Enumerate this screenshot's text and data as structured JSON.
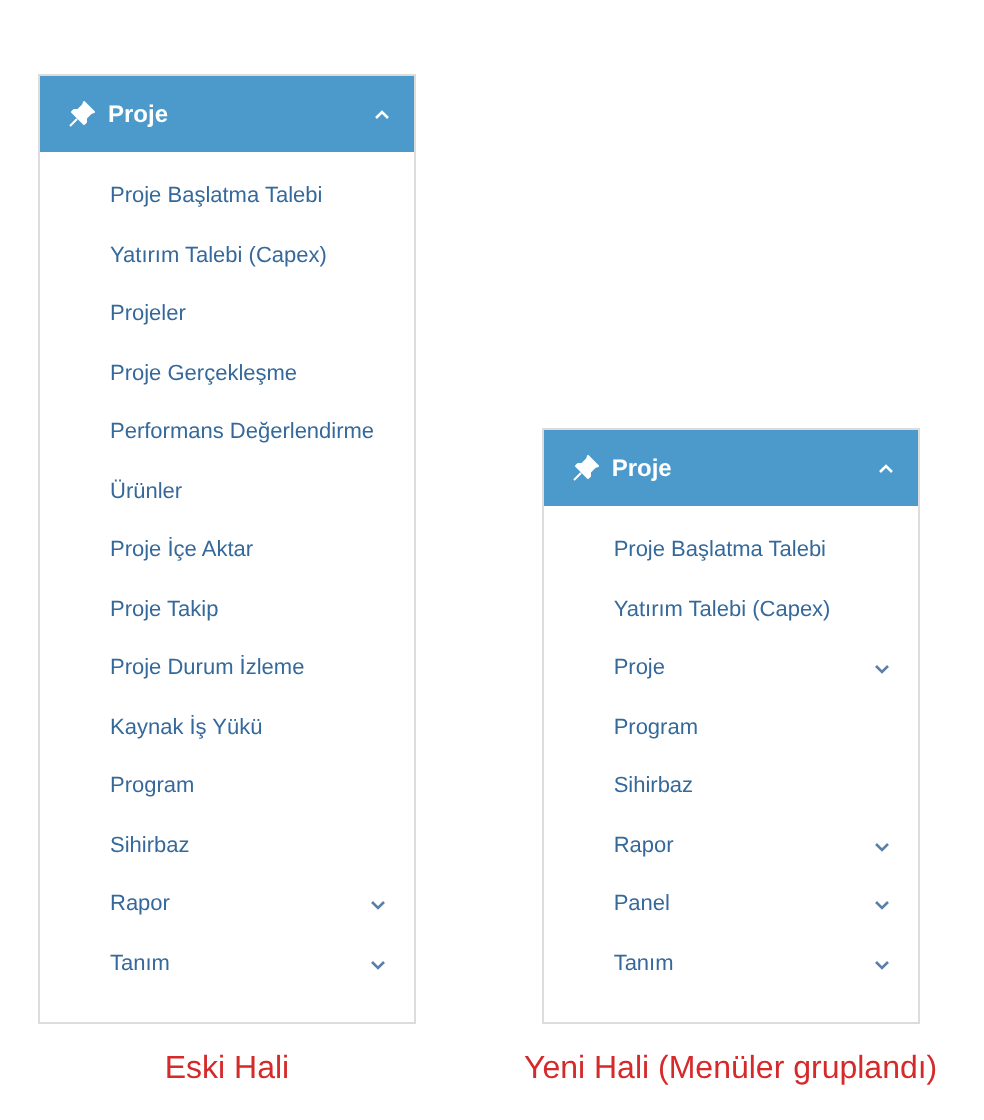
{
  "panels": [
    {
      "header": {
        "title": "Proje",
        "expanded": true
      },
      "items": [
        {
          "kind": "link",
          "label": "Proje Başlatma Talebi"
        },
        {
          "kind": "link",
          "label": "Yatırım Talebi (Capex)"
        },
        {
          "kind": "link",
          "label": "Projeler"
        },
        {
          "kind": "link",
          "label": "Proje Gerçekleşme"
        },
        {
          "kind": "link",
          "label": "Performans Değerlendirme"
        },
        {
          "kind": "link",
          "label": "Ürünler"
        },
        {
          "kind": "link",
          "label": "Proje İçe Aktar"
        },
        {
          "kind": "link",
          "label": "Proje Takip"
        },
        {
          "kind": "link",
          "label": "Proje Durum İzleme"
        },
        {
          "kind": "link",
          "label": "Kaynak İş Yükü"
        },
        {
          "kind": "link",
          "label": "Program"
        },
        {
          "kind": "link",
          "label": "Sihirbaz"
        },
        {
          "kind": "group",
          "label": "Rapor"
        },
        {
          "kind": "group",
          "label": "Tanım"
        }
      ],
      "caption": "Eski Hali"
    },
    {
      "header": {
        "title": "Proje",
        "expanded": true
      },
      "items": [
        {
          "kind": "link",
          "label": "Proje Başlatma Talebi"
        },
        {
          "kind": "link",
          "label": "Yatırım Talebi (Capex)"
        },
        {
          "kind": "group",
          "label": "Proje"
        },
        {
          "kind": "link",
          "label": "Program"
        },
        {
          "kind": "link",
          "label": "Sihirbaz"
        },
        {
          "kind": "group",
          "label": "Rapor"
        },
        {
          "kind": "group",
          "label": "Panel"
        },
        {
          "kind": "group",
          "label": "Tanım"
        }
      ],
      "caption": "Yeni Hali (Menüler gruplandı)"
    }
  ]
}
